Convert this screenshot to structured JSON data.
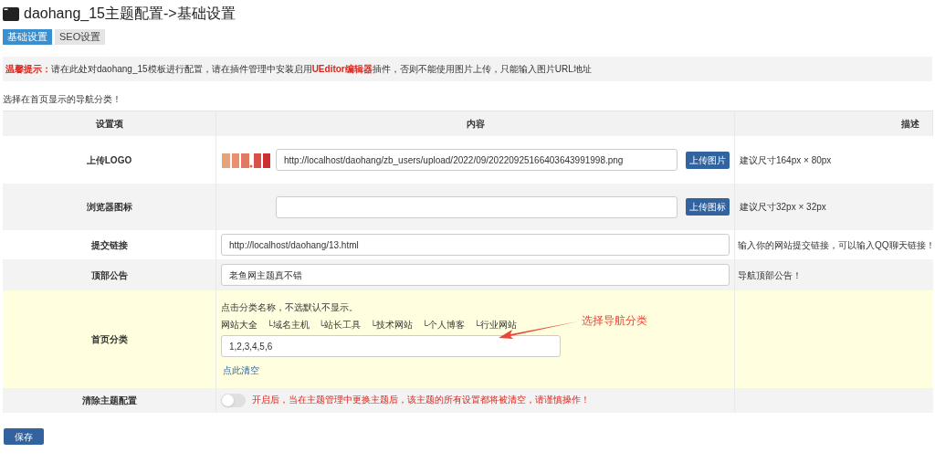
{
  "page_title": "daohang_15主题配置->基础设置",
  "tabs": [
    {
      "label": "基础设置",
      "selected": true
    },
    {
      "label": "SEO设置",
      "selected": false
    }
  ],
  "notice": {
    "label": "温馨提示：",
    "text": "请在此处对daohang_15模板进行配置，请在插件管理中安装启用**UEditor编辑器**插件，否则不能使用图片上传，只能输入图片URL地址"
  },
  "hint": "选择在首页显示的导航分类！",
  "table": {
    "columns": [
      "设置项",
      "内容",
      "描述"
    ],
    "rows": [
      {
        "kind": "upload",
        "label": "上传LOGO",
        "value": "http://localhost/daohang/zb_users/upload/2022/09/20220925166403643991998.png",
        "button": "上传图片",
        "description": "建议尺寸164px × 80px"
      },
      {
        "kind": "upload",
        "label": "浏览器图标",
        "button": "上传图标",
        "description": "建议尺寸32px × 32px"
      },
      {
        "kind": "text",
        "label": "提交链接",
        "value": "http://localhost/daohang/13.html",
        "description": "输入你的网站提交链接，可以输入QQ聊天链接！"
      },
      {
        "kind": "text",
        "label": "顶部公告",
        "value": "老鱼网主题真不错",
        "description": "导航顶部公告！"
      },
      {
        "kind": "categories",
        "label": "首页分类",
        "instruction": "点击分类名称，不选默认不显示。",
        "categories": [
          "网站大全",
          "└域名主机",
          "└站长工具",
          "└技术网站",
          "└个人博客",
          "└行业网站"
        ],
        "value": "1,2,3,4,5,6",
        "clear_link": "点此清空",
        "annotation": "选择导航分类"
      },
      {
        "kind": "toggle",
        "label": "清除主题配置",
        "on": false,
        "warning": "开启后，当在主题管理中更换主题后，该主题的所有设置都将被清空，请谨慎操作！"
      }
    ]
  },
  "save_button": "保存"
}
